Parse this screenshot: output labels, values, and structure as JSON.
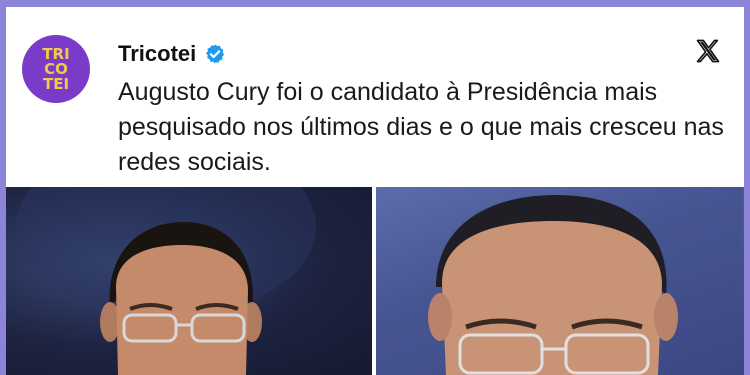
{
  "account": {
    "display_name": "Tricotei",
    "avatar_lines": [
      "TRI",
      "CO",
      "TEI"
    ],
    "avatar_bg": "#7a3cc8",
    "avatar_fg": "#f3c94a",
    "verified_icon": "verified-badge-icon",
    "verified_color": "#1d9bf0"
  },
  "post": {
    "text": "Augusto Cury foi o candidato à Presidência mais pesquisado nos últimos dias e o que mais cresceu nas redes sociais."
  },
  "platform_icon": "x-logo-icon",
  "colors": {
    "frame": "#8c84d8",
    "card": "#ffffff",
    "text": "#1a1a1a"
  }
}
